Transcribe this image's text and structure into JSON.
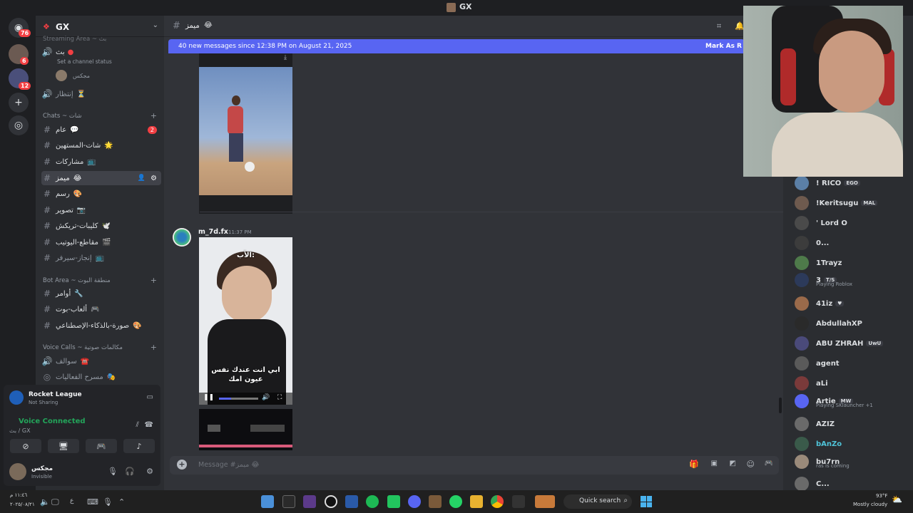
{
  "window": {
    "title": "GX"
  },
  "rail": {
    "badges": [
      "76",
      "6",
      "12"
    ]
  },
  "server": {
    "name": "GX"
  },
  "sidebar": {
    "partial_top": "Streaming Area ~ بث",
    "voice_now": {
      "label": "بث",
      "status_hint": "Set a channel status",
      "member": "مجكس"
    },
    "waiting": "إنتظار",
    "chats_category": "Chats ~ شات",
    "channels": [
      {
        "name": "عام",
        "emoji": "💬",
        "unread": "2"
      },
      {
        "name": "شات-المستهين",
        "emoji": "🌟"
      },
      {
        "name": "مشاركات",
        "emoji": "📺"
      },
      {
        "name": "ميمز",
        "emoji": "😂",
        "active": true
      },
      {
        "name": "رسم",
        "emoji": "🎨"
      },
      {
        "name": "تصوير",
        "emoji": "📷"
      },
      {
        "name": "كليبات-تريكش",
        "emoji": "🕊️"
      },
      {
        "name": "مقاطع-اليوتيب",
        "emoji": "🎬"
      },
      {
        "name": "إنجاز-سيرفر",
        "emoji": "📺"
      }
    ],
    "bot_category": "Bot Area ~ منطقة البوت",
    "bot_channels": [
      {
        "name": "أوامر",
        "emoji": "🔧"
      },
      {
        "name": "ألعاب-بوت",
        "emoji": "🎮"
      },
      {
        "name": "صورة-بالذكاء-الإصطناعي",
        "emoji": "🎨"
      }
    ],
    "voice_category": "Voice Calls ~ مكالمات صوتية",
    "voice_channels": [
      {
        "name": "سوالف",
        "emoji": "☎️"
      },
      {
        "name": "مسرح الفعاليات",
        "emoji": "🎭"
      }
    ]
  },
  "game": {
    "title": "Rocket League",
    "status": "Not Sharing"
  },
  "voice": {
    "status": "Voice Connected",
    "channel": "بث / GX"
  },
  "user": {
    "name": "مجكس",
    "status": "Invisible"
  },
  "chat": {
    "channel": "ميمز",
    "new_messages": "40 new messages since 12:38 PM on August 21, 2025",
    "mark_as_read": "Mark As R",
    "author": "m_7d.fx",
    "time": "11:37 PM",
    "caption_top": "الأب:",
    "caption_bottom": "ابي انت عندك نفس عيون امك",
    "composer_placeholder": "Message #ميمز 😂"
  },
  "members": [
    {
      "name": "! RICO",
      "tag": "EGO",
      "color": "#5b7fa6"
    },
    {
      "name": "!Keritsugu",
      "tag": "MAL",
      "color": "#6e5a4e"
    },
    {
      "name": "' Lord O",
      "color": "#4a4a4a"
    },
    {
      "name": "0...",
      "color": "#3c3c3c"
    },
    {
      "name": "1Trayz",
      "color": "#4e7a4a"
    },
    {
      "name": "3",
      "tag": "T/S",
      "sub": "Playing Roblox",
      "color": "#2c3a5a"
    },
    {
      "name": "41iz",
      "tag": "♥",
      "color": "#9a6a4a"
    },
    {
      "name": "AbdullahXP",
      "color": "#2a2a2a"
    },
    {
      "name": "ABU ZHRAH",
      "tag": "UwU",
      "color": "#4a4a7a"
    },
    {
      "name": "agent",
      "color": "#5a5a5a"
    },
    {
      "name": "aLi",
      "color": "#7a3a3a"
    },
    {
      "name": "Artie",
      "tag": "MW",
      "sub": "Playing SKlauncher +1",
      "color": "#5865f2"
    },
    {
      "name": "AZIZ",
      "color": "#6a6a6a"
    },
    {
      "name": "bAnZo",
      "color": "#3a5a4a",
      "teal": true
    },
    {
      "name": "bu7rn",
      "sub": "ras is coming",
      "color": "#9a8a7a"
    },
    {
      "name": "C...",
      "color": "#6a6a6a"
    }
  ],
  "taskbar": {
    "time": "١١:٤٦ م",
    "date": "٢٠٢٥/٠٨/٢١",
    "search": "Quick search",
    "weather_temp": "93°F",
    "weather_desc": "Mostly cloudy"
  }
}
